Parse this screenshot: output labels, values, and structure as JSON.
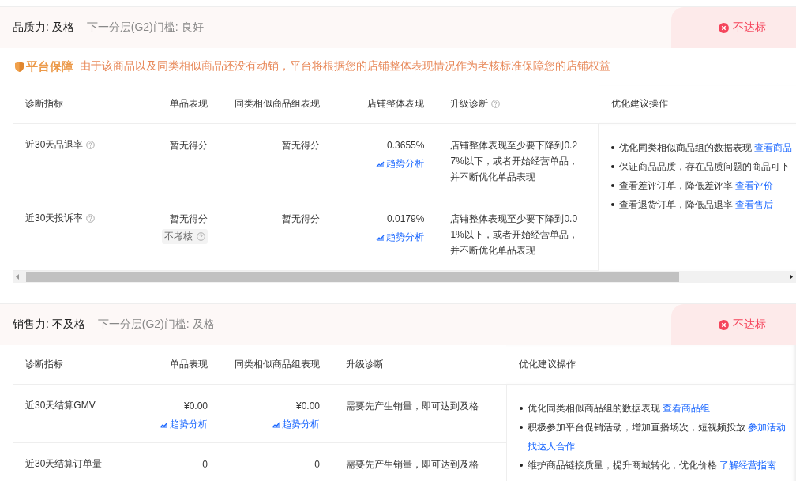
{
  "sections": [
    {
      "title": "品质力: 及格",
      "next_threshold": "下一分层(G2)门槛: 良好",
      "status": {
        "text": "不达标",
        "passed": false
      },
      "notice": {
        "badge": "平台保障",
        "text": "由于该商品以及同类相似商品还没有动销，平台将根据您的店铺整体表现情况作为考核标准保障您的店铺权益"
      },
      "columns": [
        {
          "label": "诊断指标",
          "kind": "metric",
          "help": false
        },
        {
          "label": "单品表现",
          "kind": "value",
          "help": false
        },
        {
          "label": "同类相似商品组表现",
          "kind": "value",
          "help": false
        },
        {
          "label": "店铺整体表现",
          "kind": "value",
          "help": false
        },
        {
          "label": "升级诊断",
          "kind": "diagnosis",
          "help": true
        },
        {
          "label": "优化建议操作",
          "kind": "actions",
          "help": false
        }
      ],
      "rows": [
        {
          "metric": "近30天品退率",
          "help": true,
          "values": [
            {
              "text": "暂无得分"
            },
            {
              "text": "暂无得分"
            },
            {
              "text": "0.3655%",
              "trend": "趋势分析"
            }
          ],
          "diagnosis": "店铺整体表现至少要下降到0.27%以下，或者开始经营单品，并不断优化单品表现"
        },
        {
          "metric": "近30天投诉率",
          "help": true,
          "values": [
            {
              "text": "暂无得分",
              "tag": "不考核"
            },
            {
              "text": "暂无得分"
            },
            {
              "text": "0.0179%",
              "trend": "趋势分析"
            }
          ],
          "diagnosis": "店铺整体表现至少要下降到0.01%以下，或者开始经营单品，并不断优化单品表现"
        }
      ],
      "actions": [
        {
          "text": "优化同类相似商品组的数据表现",
          "links": [
            "查看商品"
          ]
        },
        {
          "text": "保证商品品质，存在品质问题的商品可下"
        },
        {
          "text": "查看差评订单，降低差评率",
          "links": [
            "查看评价"
          ]
        },
        {
          "text": "查看退货订单，降低品退率",
          "links": [
            "查看售后"
          ]
        }
      ],
      "scrollbar": true
    },
    {
      "title": "销售力: 不及格",
      "next_threshold": "下一分层(G2)门槛: 及格",
      "status": {
        "text": "不达标",
        "passed": false
      },
      "columns": [
        {
          "label": "诊断指标",
          "kind": "metric",
          "help": false
        },
        {
          "label": "单品表现",
          "kind": "value",
          "help": false
        },
        {
          "label": "同类相似商品组表现",
          "kind": "value",
          "help": false
        },
        {
          "label": "升级诊断",
          "kind": "diagnosis",
          "help": false
        },
        {
          "label": "优化建议操作",
          "kind": "actions",
          "help": false
        }
      ],
      "rows": [
        {
          "metric": "近30天结算GMV",
          "help": false,
          "values": [
            {
              "text": "¥0.00",
              "trend": "趋势分析"
            },
            {
              "text": "¥0.00",
              "trend": "趋势分析"
            }
          ],
          "diagnosis": "需要先产生销量，即可达到及格"
        },
        {
          "metric": "近30天结算订单量",
          "help": false,
          "values": [
            {
              "text": "0"
            },
            {
              "text": "0"
            }
          ],
          "diagnosis": "需要先产生销量，即可达到及格"
        }
      ],
      "actions": [
        {
          "text": "优化同类相似商品组的数据表现",
          "links": [
            "查看商品组"
          ]
        },
        {
          "text": "积极参加平台促销活动，增加直播场次，短视频投放",
          "links": [
            "参加活动",
            "找达人合作"
          ]
        },
        {
          "text": "维护商品链接质量，提升商城转化，优化价格",
          "links": [
            "了解经营指南"
          ]
        }
      ],
      "scrollbar": false
    }
  ]
}
